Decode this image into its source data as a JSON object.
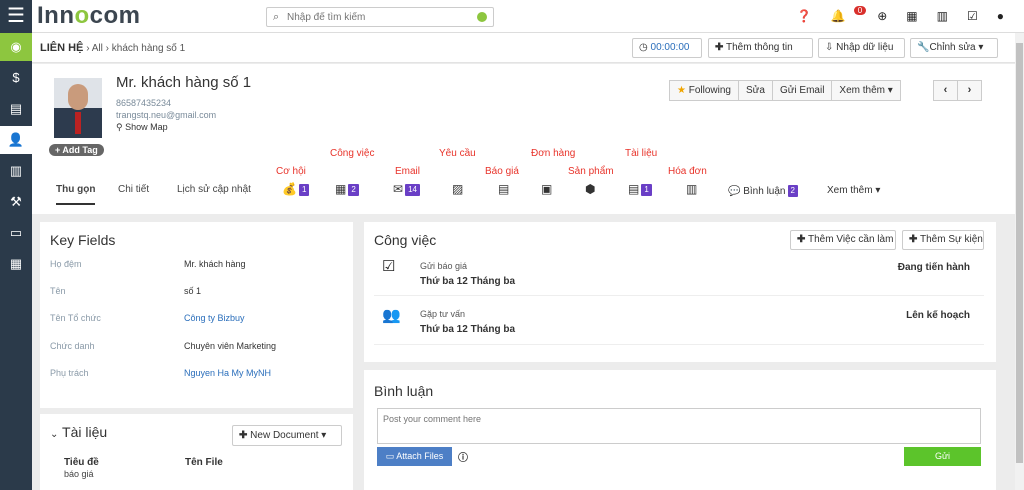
{
  "app": {
    "logo": "Innocom",
    "logo_pre": "Inn",
    "logo_o": "o",
    "logo_post": "com"
  },
  "search": {
    "placeholder": "Nhập để tìm kiếm"
  },
  "topbar": {
    "notif_count": "0"
  },
  "breadcrumb": {
    "section": "LIÊN HỆ",
    "sep": "›",
    "all": "All",
    "current": "khách hàng số 1"
  },
  "toolbar": {
    "timer": "00:00:00",
    "add_info": "Thêm thông tin",
    "import": "Nhập dữ liệu",
    "edit": "Chỉnh sửa"
  },
  "profile": {
    "name": "Mr. khách hàng số 1",
    "phone": "86587435234",
    "email": "trangstq.neu@gmail.com",
    "map": "Show Map",
    "add_tag": "+ Add Tag",
    "actions": {
      "following": "Following",
      "edit": "Sửa",
      "send_email": "Gửi Email",
      "more": "Xem thêm"
    }
  },
  "annotations": {
    "co_hoi": "Cơ hội",
    "cong_viec": "Công việc",
    "email": "Email",
    "yeu_cau": "Yêu cầu",
    "bao_gia": "Báo giá",
    "don_hang": "Đơn hàng",
    "san_pham": "Sản phẩm",
    "tai_lieu": "Tài liệu",
    "hoa_don": "Hóa đơn"
  },
  "tabs": {
    "compact": "Thu gọn",
    "detail": "Chi tiết",
    "history": "Lịch sử cập nhật",
    "comments": "Bình luận",
    "comments_count": "2",
    "more": "Xem thêm"
  },
  "tool_counts": {
    "co_hoi": "1",
    "cong_viec": "2",
    "email": "14",
    "tai_lieu": "1"
  },
  "key_fields": {
    "title": "Key Fields",
    "rows": [
      {
        "label": "Họ đệm",
        "value": "Mr. khách hàng"
      },
      {
        "label": "Tên",
        "value": "số 1"
      },
      {
        "label": "Tên Tổ chức",
        "value": "Công ty Bizbuy"
      },
      {
        "label": "Chức danh",
        "value": "Chuyên viên Marketing"
      },
      {
        "label": "Phụ trách",
        "value": "Nguyen Ha My MyNH"
      }
    ]
  },
  "documents": {
    "title": "Tài liệu",
    "new_button": "New Document",
    "col_title": "Tiêu đề",
    "col_file": "Tên File",
    "row1_title": "báo giá"
  },
  "tasks": {
    "title": "Công việc",
    "add_task": "Thêm Việc cần làm",
    "add_event": "Thêm Sự kiện",
    "items": [
      {
        "name": "Gửi báo giá",
        "date": "Thứ ba 12 Tháng ba",
        "status": "Đang tiến hành"
      },
      {
        "name": "Gặp tư vấn",
        "date": "Thứ ba 12 Tháng ba",
        "status": "Lên kế hoạch"
      }
    ]
  },
  "comments": {
    "title": "Bình luận",
    "placeholder": "Post your comment here",
    "attach": "Attach Files",
    "send": "Gửi"
  },
  "colors": {
    "accent": "#8dc63f",
    "sidebar": "#2b3a4a",
    "annotation": "#e8332a",
    "badge": "#6a3fc6"
  }
}
